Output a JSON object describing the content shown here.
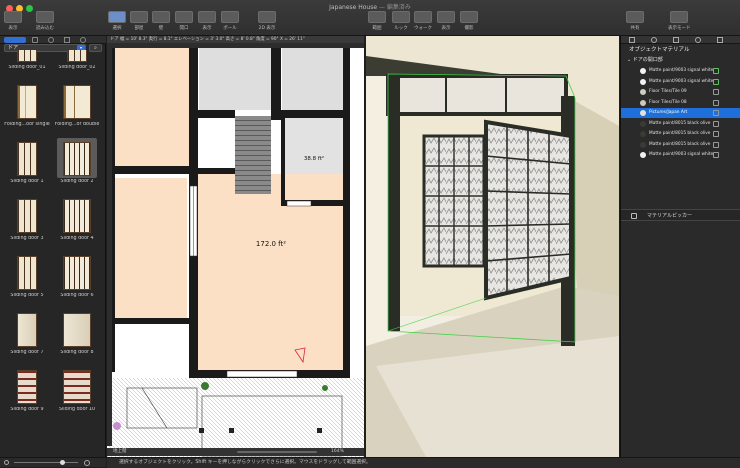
{
  "window": {
    "title": "Japanese House",
    "subtitle": "— 編集済み"
  },
  "toolbar": {
    "left": [
      {
        "label": "表示",
        "icon": "view-icon"
      },
      {
        "label": "読み込む",
        "icon": "import-icon"
      }
    ],
    "center": [
      {
        "label": "選択",
        "icon": "select-icon"
      },
      {
        "label": "部屋",
        "icon": "room-icon"
      },
      {
        "label": "壁",
        "icon": "wall-icon"
      },
      {
        "label": "開口",
        "icon": "opening-icon"
      },
      {
        "label": "表示",
        "icon": "display-icon"
      },
      {
        "label": "ポール",
        "icon": "pole-icon"
      },
      {
        "label": "2D 表示",
        "icon": "2d-icon"
      }
    ],
    "view3d": [
      {
        "label": "範囲",
        "icon": "range-icon"
      },
      {
        "label": "ルック",
        "icon": "look-icon"
      },
      {
        "label": "ウォーク",
        "icon": "walk-icon"
      },
      {
        "label": "表示",
        "icon": "display3d-icon"
      },
      {
        "label": "撮影",
        "icon": "camera-icon"
      }
    ],
    "right": [
      {
        "label": "共有",
        "icon": "share-icon"
      },
      {
        "label": "表示モード",
        "icon": "viewmode-icon"
      }
    ]
  },
  "library": {
    "category": "ドア",
    "items": [
      {
        "label": "Sliding door_01",
        "kind": "shoji"
      },
      {
        "label": "Sliding door_02",
        "kind": "shoji"
      },
      {
        "label": "Folding...oor single",
        "kind": "fold"
      },
      {
        "label": "Folding...or double",
        "kind": "fold"
      },
      {
        "label": "Sliding door 1",
        "kind": "shoji"
      },
      {
        "label": "Sliding door 2",
        "kind": "shoji2",
        "selected": true
      },
      {
        "label": "Sliding door 3",
        "kind": "shoji"
      },
      {
        "label": "Sliding door 4",
        "kind": "shoji2"
      },
      {
        "label": "Sliding door 5",
        "kind": "shoji"
      },
      {
        "label": "Sliding door 6",
        "kind": "shoji2"
      },
      {
        "label": "Sliding door 7",
        "kind": "plain"
      },
      {
        "label": "Sliding door 8",
        "kind": "plain2"
      },
      {
        "label": "Sliding door 9",
        "kind": "red"
      },
      {
        "label": "Sliding door 10",
        "kind": "red2"
      }
    ]
  },
  "plan": {
    "header": "ドア   幅 = 10' 8.3\"   奥行 = 8.1\"   エレベーション = 3' 3.0\"   高さ = 8' 0.8\"   角度 = 90°   X = 26' 11\"",
    "room_large_area": "172.0 ft²",
    "room_small_area": "38.8 ft²",
    "level_label": "地上階",
    "zoom": "164%"
  },
  "materials": {
    "panel_title": "オブジェクトマテリアル",
    "section": "ドアの開口部",
    "rows": [
      {
        "name": "Matte paint/9003 signal white",
        "color": "#f2f2f2",
        "selected": false
      },
      {
        "name": "Matte paint/9003 signal white",
        "color": "#f2f2f2",
        "selected": false
      },
      {
        "name": "Floor Tiles/Tile 09",
        "color": "#d0ccc4",
        "selected": false
      },
      {
        "name": "Floor Tiles/Tile 08",
        "color": "#cfc9bd",
        "selected": false
      },
      {
        "name": "Pictures/Japan Art",
        "color": "#e8e2d6",
        "selected": true
      },
      {
        "name": "Matte paint/8015 black olive",
        "color": "#3a3b34",
        "selected": false
      },
      {
        "name": "Matte paint/8015 black olive",
        "color": "#3a3b34",
        "selected": false
      },
      {
        "name": "Matte paint/8015 black olive",
        "color": "#3a3b34",
        "selected": false
      },
      {
        "name": "Matte paint/9003 signal white",
        "color": "#f2f2f2",
        "selected": false
      }
    ],
    "picker_label": "マテリアルピッカー"
  },
  "status": "選択するオブジェクトをクリック。Shift キーを押しながらクリックでさらに選択。マウスをドラッグして範囲選択。",
  "colors": {
    "accent": "#1e6fd9",
    "room_fill": "#fce0c6",
    "wall": "#1a1a1a"
  }
}
